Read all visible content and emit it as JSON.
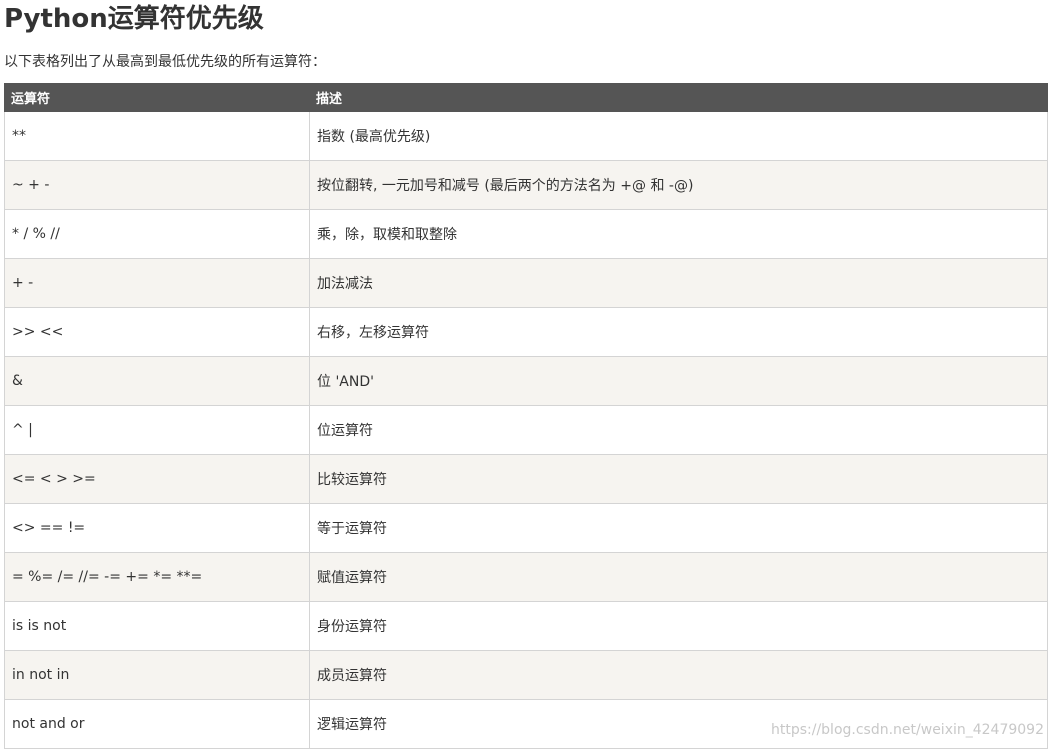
{
  "title": "Python运算符优先级",
  "intro": "以下表格列出了从最高到最低优先级的所有运算符：",
  "table": {
    "headers": [
      "运算符",
      "描述"
    ],
    "rows": [
      [
        "**",
        "指数 (最高优先级)"
      ],
      [
        "~ + -",
        "按位翻转, 一元加号和减号 (最后两个的方法名为 +@ 和 -@)"
      ],
      [
        "* / % //",
        "乘，除，取模和取整除"
      ],
      [
        "+ -",
        "加法减法"
      ],
      [
        ">> <<",
        "右移，左移运算符"
      ],
      [
        "&",
        "位 'AND'"
      ],
      [
        "^ |",
        "位运算符"
      ],
      [
        "<= < > >=",
        "比较运算符"
      ],
      [
        "<> == !=",
        "等于运算符"
      ],
      [
        "= %= /= //= -= += *= **=",
        "赋值运算符"
      ],
      [
        "is is not",
        "身份运算符"
      ],
      [
        "in not in",
        "成员运算符"
      ],
      [
        "not and or",
        "逻辑运算符"
      ]
    ]
  },
  "watermark": "https://blog.csdn.net/weixin_42479092",
  "colors": {
    "header_bg": "#555555",
    "header_text": "#ffffff",
    "row_alt_bg": "#f6f4f0",
    "border": "#d4d4d4",
    "text": "#333333"
  }
}
